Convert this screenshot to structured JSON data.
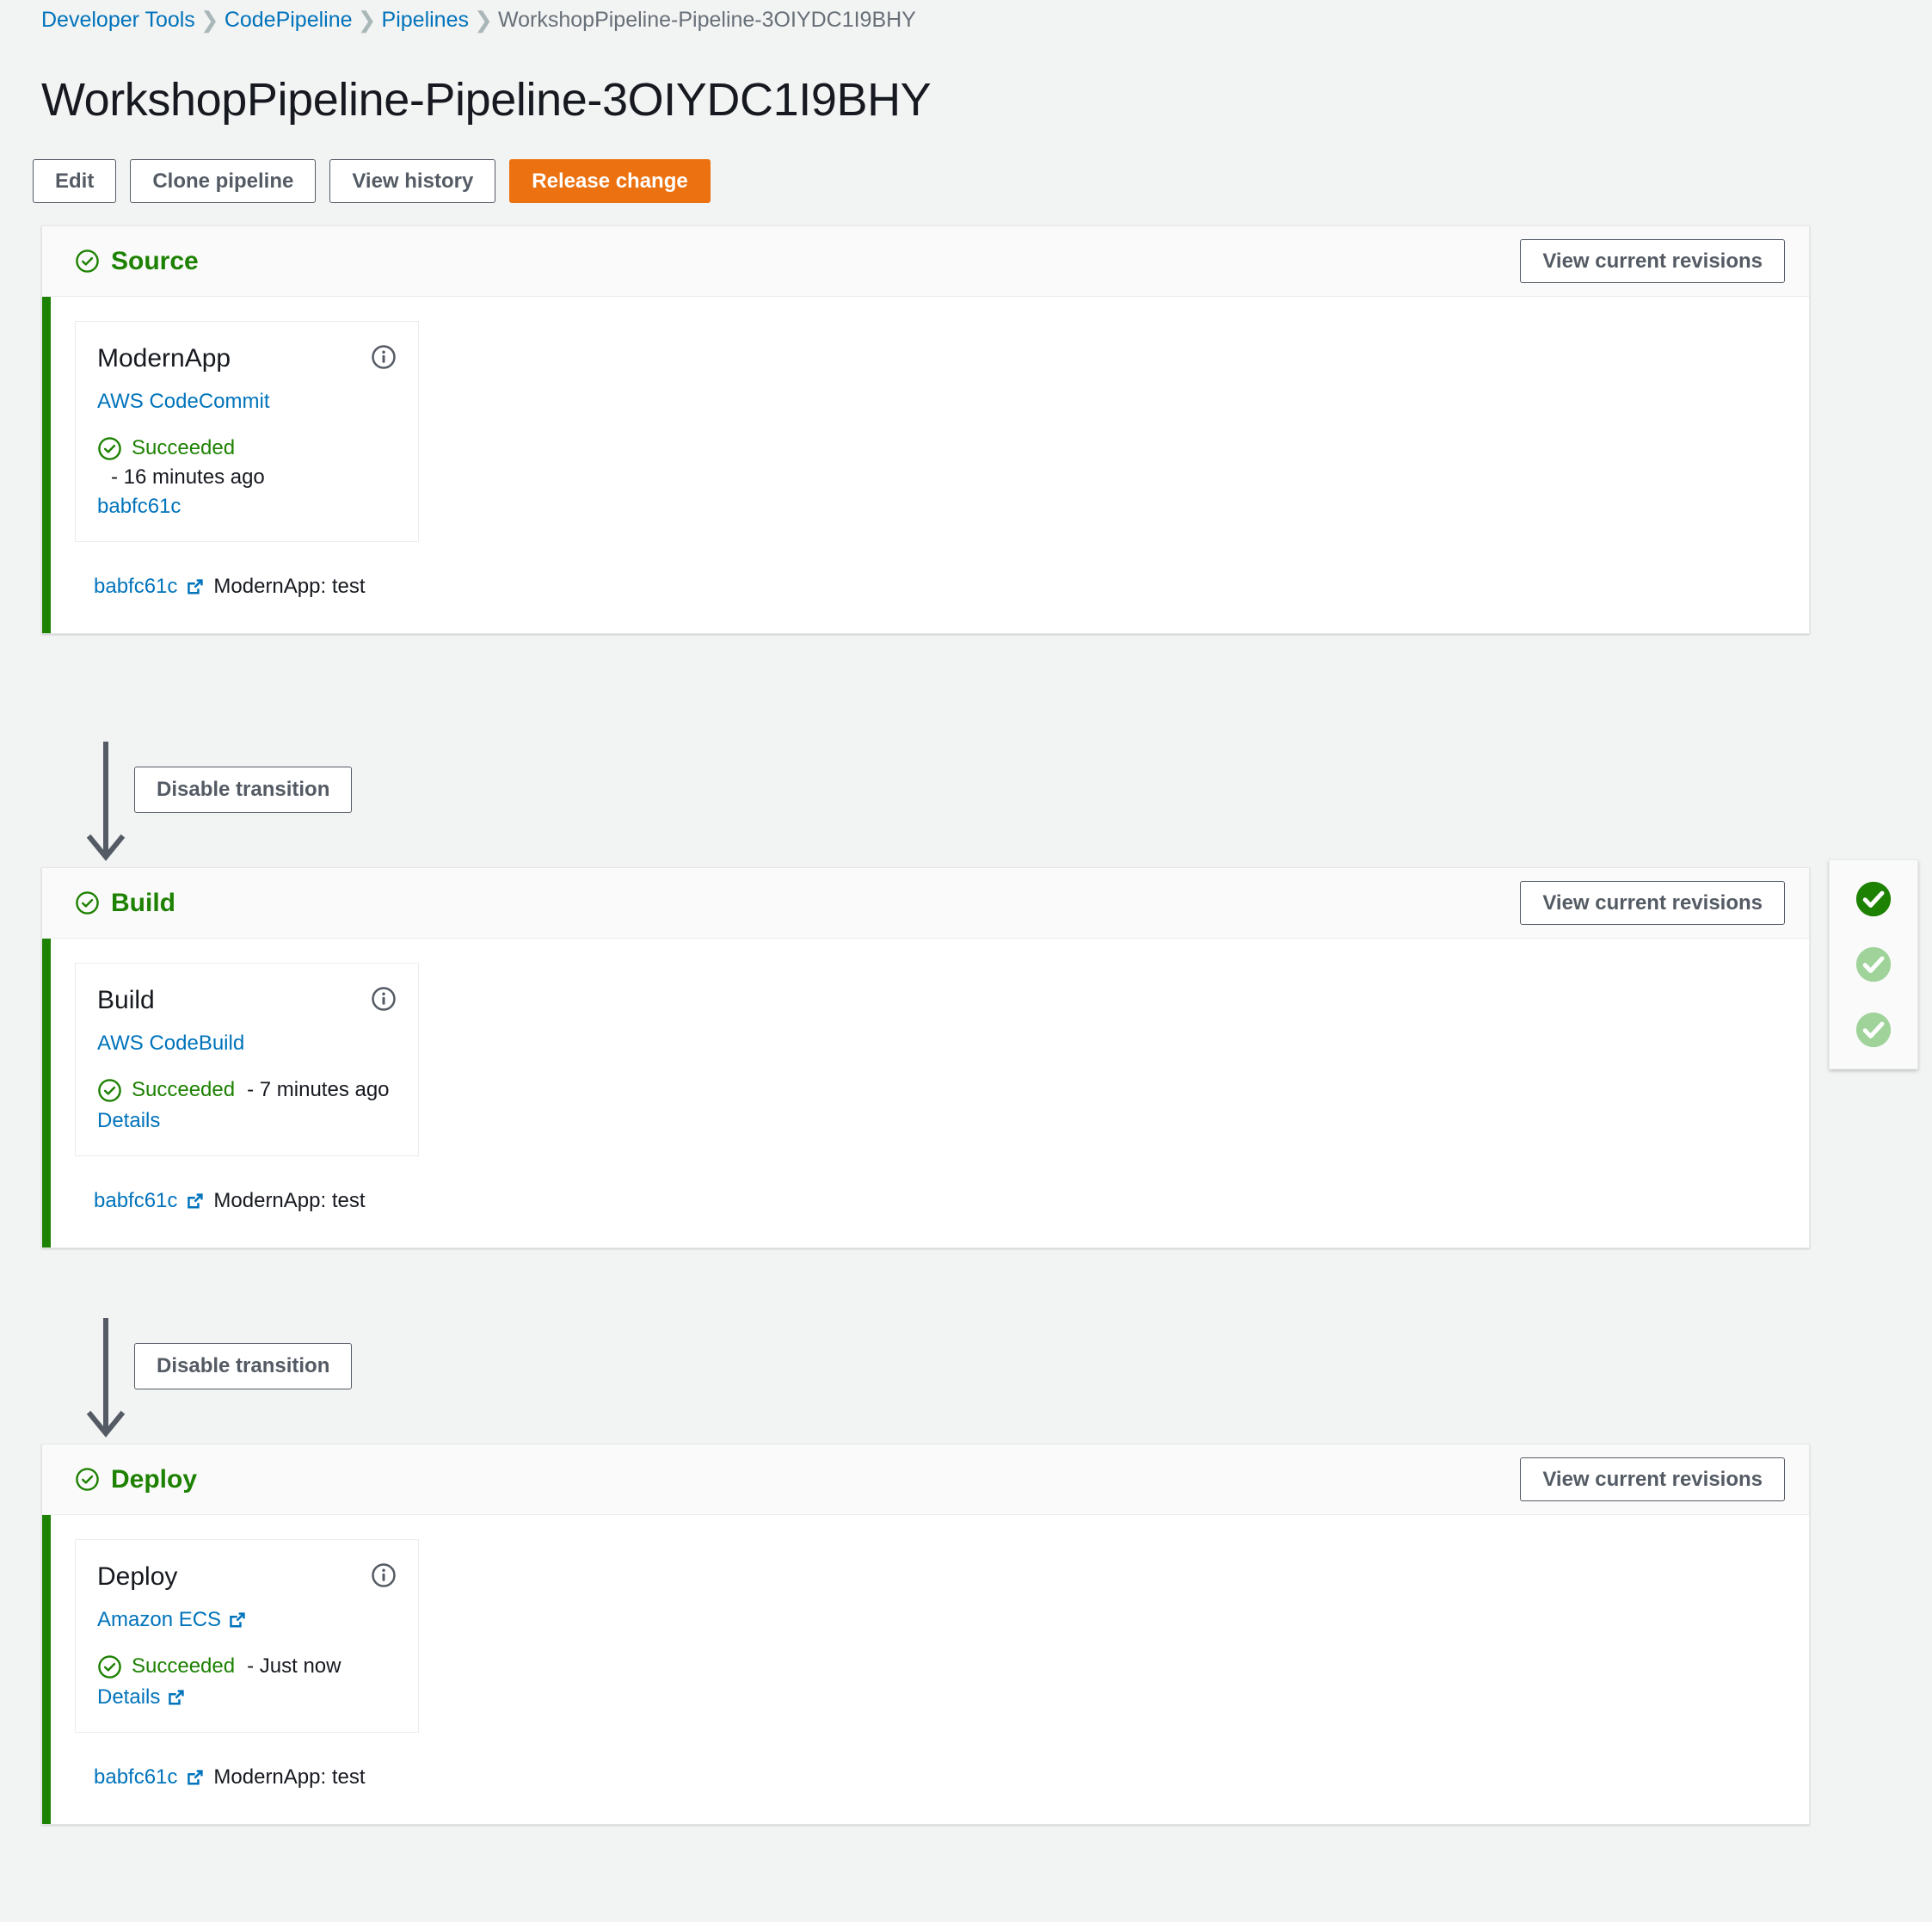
{
  "breadcrumb": {
    "items": [
      {
        "label": "Developer Tools",
        "current": false
      },
      {
        "label": "CodePipeline",
        "current": false
      },
      {
        "label": "Pipelines",
        "current": false
      },
      {
        "label": "WorkshopPipeline-Pipeline-3OIYDC1I9BHY",
        "current": true
      }
    ],
    "separator": "›"
  },
  "page_title": "WorkshopPipeline-Pipeline-3OIYDC1I9BHY",
  "toolbar": {
    "edit_label": "Edit",
    "clone_label": "Clone pipeline",
    "history_label": "View history",
    "release_label": "Release change"
  },
  "common": {
    "view_revisions_label": "View current revisions",
    "disable_transition_label": "Disable transition",
    "succeeded_label": "Succeeded",
    "details_label": "Details",
    "dash": "-"
  },
  "colors": {
    "accent_green": "#1d8102",
    "link_blue": "#0073bb",
    "primary_orange": "#ec7211",
    "border_gray": "#545b64",
    "minimap_active": "#1d8102",
    "minimap_inactive": "#9fd39a"
  },
  "stages": [
    {
      "name": "Source",
      "status": "Succeeded",
      "view_revisions_label": "View current revisions",
      "action": {
        "title": "ModernApp",
        "provider": "AWS CodeCommit",
        "provider_external": false,
        "status": "Succeeded",
        "time": "16 minutes ago",
        "time_on_second_line": true,
        "revision_link": "babfc61c",
        "details_link": null,
        "details_external": false
      },
      "commit": {
        "id": "babfc61c",
        "message": "ModernApp: test"
      }
    },
    {
      "name": "Build",
      "status": "Succeeded",
      "view_revisions_label": "View current revisions",
      "action": {
        "title": "Build",
        "provider": "AWS CodeBuild",
        "provider_external": false,
        "status": "Succeeded",
        "time": "7 minutes ago",
        "time_on_second_line": false,
        "revision_link": null,
        "details_link": "Details",
        "details_external": false
      },
      "commit": {
        "id": "babfc61c",
        "message": "ModernApp: test"
      }
    },
    {
      "name": "Deploy",
      "status": "Succeeded",
      "view_revisions_label": "View current revisions",
      "action": {
        "title": "Deploy",
        "provider": "Amazon ECS",
        "provider_external": true,
        "status": "Succeeded",
        "time": "Just now",
        "time_on_second_line": false,
        "revision_link": null,
        "details_link": "Details",
        "details_external": true
      },
      "commit": {
        "id": "babfc61c",
        "message": "ModernApp: test"
      }
    }
  ],
  "transitions": [
    {
      "label": "Disable transition"
    },
    {
      "label": "Disable transition"
    }
  ],
  "minimap": {
    "stages": [
      {
        "state": "active"
      },
      {
        "state": "inactive"
      },
      {
        "state": "inactive"
      }
    ]
  }
}
